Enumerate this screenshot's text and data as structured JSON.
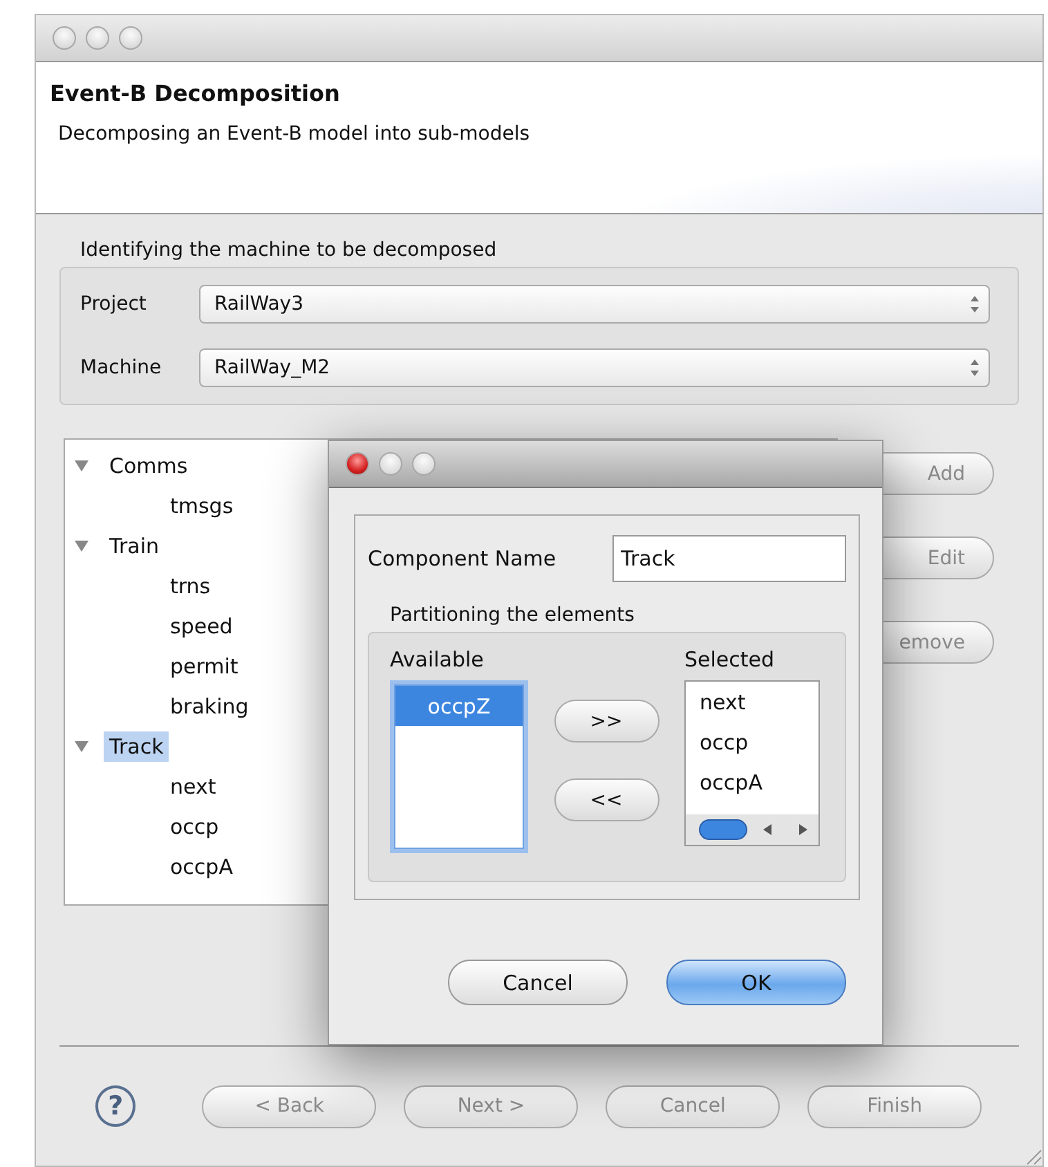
{
  "wizard": {
    "title": "Event-B Decomposition",
    "description": "Decomposing an Event-B model into sub-models"
  },
  "machine_group": {
    "title": "Identifying the machine to be decomposed",
    "fields": [
      {
        "label": "Project",
        "value": "RailWay3"
      },
      {
        "label": "Machine",
        "value": "RailWay_M2"
      }
    ]
  },
  "tree": [
    {
      "label": "Comms",
      "expanded": true,
      "selected": false,
      "children": [
        {
          "label": "tmsgs",
          "selected": false
        }
      ]
    },
    {
      "label": "Train",
      "expanded": true,
      "selected": false,
      "children": [
        {
          "label": "trns",
          "selected": false
        },
        {
          "label": "speed",
          "selected": false
        },
        {
          "label": "permit",
          "selected": false
        },
        {
          "label": "braking",
          "selected": false
        }
      ]
    },
    {
      "label": "Track",
      "expanded": true,
      "selected": true,
      "children": [
        {
          "label": "next",
          "selected": false
        },
        {
          "label": "occp",
          "selected": false
        },
        {
          "label": "occpA",
          "selected": false
        }
      ]
    }
  ],
  "side_buttons": [
    {
      "label": "Add",
      "disabled": true
    },
    {
      "label": "Edit",
      "disabled": true
    },
    {
      "label": "emove",
      "disabled": true
    }
  ],
  "dialog": {
    "name_label": "Component Name",
    "name_value": "Track",
    "partition_title": "Partitioning the elements",
    "available": {
      "title": "Available",
      "items": [
        {
          "label": "occpZ",
          "selected": true
        }
      ]
    },
    "chosen": {
      "title": "Selected",
      "items": [
        {
          "label": "next",
          "selected": false
        },
        {
          "label": "occp",
          "selected": false
        },
        {
          "label": "occpA",
          "selected": false
        }
      ]
    },
    "move_buttons": [
      ">>",
      "<<"
    ],
    "buttons": [
      {
        "label": "Cancel",
        "default": false
      },
      {
        "label": "OK",
        "default": true
      }
    ]
  },
  "help_symbol": "?",
  "footer_buttons": [
    {
      "label": "< Back",
      "disabled": true
    },
    {
      "label": "Next >",
      "disabled": true
    },
    {
      "label": "Cancel",
      "disabled": true
    },
    {
      "label": "Finish",
      "disabled": true
    }
  ]
}
